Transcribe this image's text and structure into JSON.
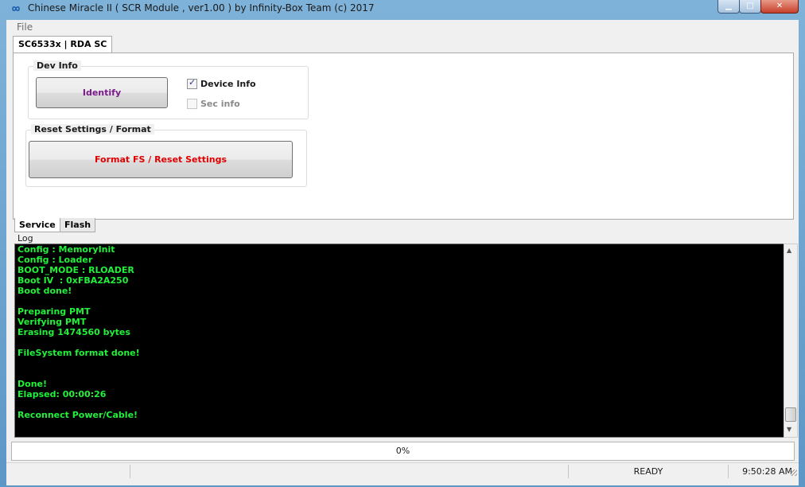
{
  "window": {
    "title": "Chinese Miracle II ( SCR Module , ver1.00  ) by Infinity-Box Team (c) 2017"
  },
  "menu": {
    "file": "File"
  },
  "top_tab": "SC6533x | RDA SC",
  "dev_info": {
    "title": "Dev Info",
    "identify_label": "Identify",
    "device_info_label": "Device Info",
    "device_info_checked": true,
    "sec_info_label": "Sec info",
    "sec_info_enabled": false
  },
  "reset": {
    "title": "Reset Settings / Format",
    "format_label": "Format FS / Reset Settings"
  },
  "bottom_tabs": {
    "service": "Service",
    "flash": "Flash"
  },
  "log": {
    "label": "Log",
    "lines": [
      "Config : MemoryInit",
      "Config : Loader",
      "BOOT_MODE : RLOADER",
      "Boot IV  : 0xFBA2A250",
      "Boot done!",
      "",
      "Preparing PMT",
      "Verifying PMT",
      "Erasing 1474560 bytes",
      "",
      "FileSystem format done!",
      "",
      "",
      "Done!",
      "Elapsed: 00:00:26",
      "",
      "Reconnect Power/Cable!"
    ]
  },
  "progress": {
    "text": "0%",
    "value": 0
  },
  "status": {
    "state": "READY",
    "time": "9:50:28 AM"
  },
  "colors": {
    "log_text": "#22f03a",
    "identify": "#7a1b8a",
    "format": "#e00000"
  }
}
